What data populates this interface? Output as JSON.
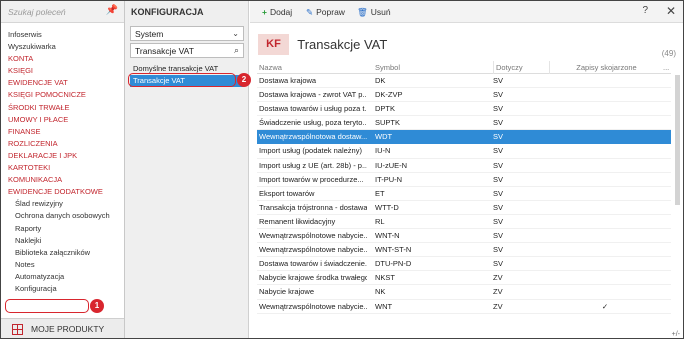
{
  "left": {
    "search_placeholder": "Szukaj poleceń",
    "items": [
      {
        "label": "Infoserwis",
        "style": "plain"
      },
      {
        "label": "Wyszukiwarka",
        "style": "plain"
      },
      {
        "label": "KONTA",
        "style": "red"
      },
      {
        "label": "KSIĘGI",
        "style": "red"
      },
      {
        "label": "EWIDENCJE VAT",
        "style": "red"
      },
      {
        "label": "KSIĘGI POMOCNICZE",
        "style": "red"
      },
      {
        "label": "ŚRODKI TRWAŁE",
        "style": "red"
      },
      {
        "label": "UMOWY I PŁACE",
        "style": "red"
      },
      {
        "label": "FINANSE",
        "style": "red"
      },
      {
        "label": "ROZLICZENIA",
        "style": "red"
      },
      {
        "label": "DEKLARACJE I JPK",
        "style": "red"
      },
      {
        "label": "KARTOTEKI",
        "style": "red"
      },
      {
        "label": "KOMUNIKACJA",
        "style": "red"
      },
      {
        "label": "EWIDENCJE DODATKOWE",
        "style": "red"
      },
      {
        "label": "Ślad rewizyjny",
        "style": "sub"
      },
      {
        "label": "Ochrona danych osobowych",
        "style": "sub"
      },
      {
        "label": "Raporty",
        "style": "sub"
      },
      {
        "label": "Naklejki",
        "style": "sub"
      },
      {
        "label": "Biblioteka załączników",
        "style": "sub"
      },
      {
        "label": "Notes",
        "style": "sub"
      },
      {
        "label": "Automatyzacja",
        "style": "sub"
      },
      {
        "label": "Konfiguracja",
        "style": "sub"
      }
    ],
    "bottom_label": "MOJE PRODUKTY"
  },
  "middle": {
    "header": "KONFIGURACJA",
    "select_value": "System",
    "search_value": "Transakcje VAT",
    "list": [
      {
        "label": "Domyślne transakcje VAT",
        "active": false
      },
      {
        "label": "Transakcje VAT",
        "active": true
      }
    ]
  },
  "toolbar": {
    "add_label": "Dodaj",
    "edit_label": "Popraw",
    "delete_label": "Usuń",
    "help_label": "?",
    "close_label": "✕"
  },
  "header": {
    "badge": "KF",
    "title": "Transakcje VAT",
    "count": "(49)"
  },
  "grid": {
    "columns": [
      "Nazwa",
      "Symbol",
      "Dotyczy",
      "Zapisy skojarzone",
      "..."
    ],
    "rows": [
      [
        "Dostawa krajowa",
        "DK",
        "SV",
        ""
      ],
      [
        "Dostawa krajowa - zwrot VAT p...",
        "DK-ZVP",
        "SV",
        ""
      ],
      [
        "Dostawa towarów i usług poza t...",
        "DPTK",
        "SV",
        ""
      ],
      [
        "Świadczenie usług, poza teryto...",
        "SUPTK",
        "SV",
        ""
      ],
      [
        "Wewnątrzwspólnotowa dostaw...",
        "WDT",
        "SV",
        ""
      ],
      [
        "Import usług (podatek należny)",
        "IU-N",
        "SV",
        ""
      ],
      [
        "Import usług z UE (art. 28b) - p...",
        "IU-zUE-N",
        "SV",
        ""
      ],
      [
        "Import towarów w procedurze...",
        "IT-PU-N",
        "SV",
        ""
      ],
      [
        "Eksport towarów",
        "ET",
        "SV",
        ""
      ],
      [
        "Transakcja trójstronna - dostawa",
        "WTT-D",
        "SV",
        ""
      ],
      [
        "Remanent likwidacyjny",
        "RL",
        "SV",
        ""
      ],
      [
        "Wewnątrzwspólnotowe nabycie...",
        "WNT-N",
        "SV",
        ""
      ],
      [
        "Wewnątrzwspólnotowe nabycie...",
        "WNT-ST-N",
        "SV",
        ""
      ],
      [
        "Dostawa towarów i świadczenie...",
        "DTU-PN-D",
        "SV",
        ""
      ],
      [
        "Nabycie krajowe środka trwałego",
        "NKST",
        "ZV",
        ""
      ],
      [
        "Nabycie krajowe",
        "NK",
        "ZV",
        ""
      ],
      [
        "Wewnątrzwspólnotowe nabycie...",
        "WNT",
        "ZV",
        "✓"
      ]
    ],
    "active_row": 4
  },
  "footer": "+/-",
  "callouts": [
    "1",
    "2"
  ]
}
